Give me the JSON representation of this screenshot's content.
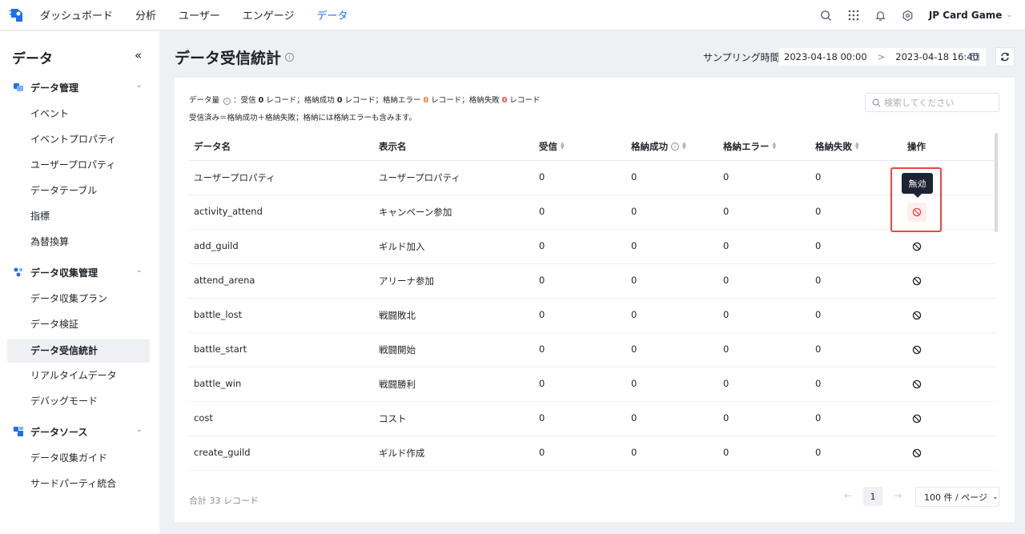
{
  "topnav": {
    "items": [
      "ダッシュボード",
      "分析",
      "ユーザー",
      "エンゲージ",
      "データ"
    ],
    "active_index": 4,
    "project": "JP Card Game",
    "icons": [
      "search-icon",
      "apps-grid-icon",
      "bell-icon",
      "settings-icon"
    ]
  },
  "sidebar": {
    "title": "データ",
    "collapse_glyph": "«",
    "groups": [
      {
        "label": "データ管理",
        "icon": "data-management-icon",
        "items": [
          "イベント",
          "イベントプロパティ",
          "ユーザープロパティ",
          "データテーブル",
          "指標",
          "為替換算"
        ]
      },
      {
        "label": "データ収集管理",
        "icon": "data-collection-icon",
        "items": [
          "データ収集プラン",
          "データ検証",
          "データ受信統計",
          "リアルタイムデータ",
          "デバッグモード"
        ]
      },
      {
        "label": "データソース",
        "icon": "data-source-icon",
        "items": [
          "データ収集ガイド",
          "サードパーティ統合"
        ]
      }
    ],
    "active_item": "データ受信統計"
  },
  "page": {
    "title": "データ受信統計",
    "sampling_label": "サンプリング時間",
    "date_start": "2023-04-18 00:00",
    "date_sep": ">",
    "date_end": "2023-04-18 16:40"
  },
  "summary": {
    "line1_prefix": "データ量",
    "line1_p1": "：受信",
    "received": "0",
    "line1_p2": "レコード；格納成功",
    "success": "0",
    "line1_p3": "レコード；格納エラー",
    "errors": "0",
    "line1_p4": "レコード；格納失敗",
    "failures": "0",
    "line1_p5": "レコード",
    "line2": "受信済み＝格納成功＋格納失敗；格納には格納エラーも含みます。"
  },
  "search": {
    "placeholder": "検索してください"
  },
  "table": {
    "columns": [
      "データ名",
      "表示名",
      "受信",
      "格納成功",
      "格納エラー",
      "格納失敗",
      "操作"
    ],
    "rows": [
      {
        "name": "ユーザープロパティ",
        "display": "ユーザープロパティ",
        "received": "0",
        "success": "0",
        "error": "0",
        "fail": "0"
      },
      {
        "name": "activity_attend",
        "display": "キャンペーン参加",
        "received": "0",
        "success": "0",
        "error": "0",
        "fail": "0"
      },
      {
        "name": "add_guild",
        "display": "ギルド加入",
        "received": "0",
        "success": "0",
        "error": "0",
        "fail": "0"
      },
      {
        "name": "attend_arena",
        "display": "アリーナ参加",
        "received": "0",
        "success": "0",
        "error": "0",
        "fail": "0"
      },
      {
        "name": "battle_lost",
        "display": "戦闘敗北",
        "received": "0",
        "success": "0",
        "error": "0",
        "fail": "0"
      },
      {
        "name": "battle_start",
        "display": "戦闘開始",
        "received": "0",
        "success": "0",
        "error": "0",
        "fail": "0"
      },
      {
        "name": "battle_win",
        "display": "戦闘勝利",
        "received": "0",
        "success": "0",
        "error": "0",
        "fail": "0"
      },
      {
        "name": "cost",
        "display": "コスト",
        "received": "0",
        "success": "0",
        "error": "0",
        "fail": "0"
      },
      {
        "name": "create_guild",
        "display": "ギルド作成",
        "received": "0",
        "success": "0",
        "error": "0",
        "fail": "0"
      }
    ],
    "action_icon": "disable-icon"
  },
  "tooltip": {
    "text": "無効"
  },
  "footer": {
    "total": "合計 33 レコード",
    "current_page": "1",
    "page_size": "100 件 / ページ"
  },
  "colors": {
    "accent": "#1e6ff1",
    "error": "#f7741c",
    "fail": "#f53f3f",
    "highlight": "#ef4444"
  }
}
